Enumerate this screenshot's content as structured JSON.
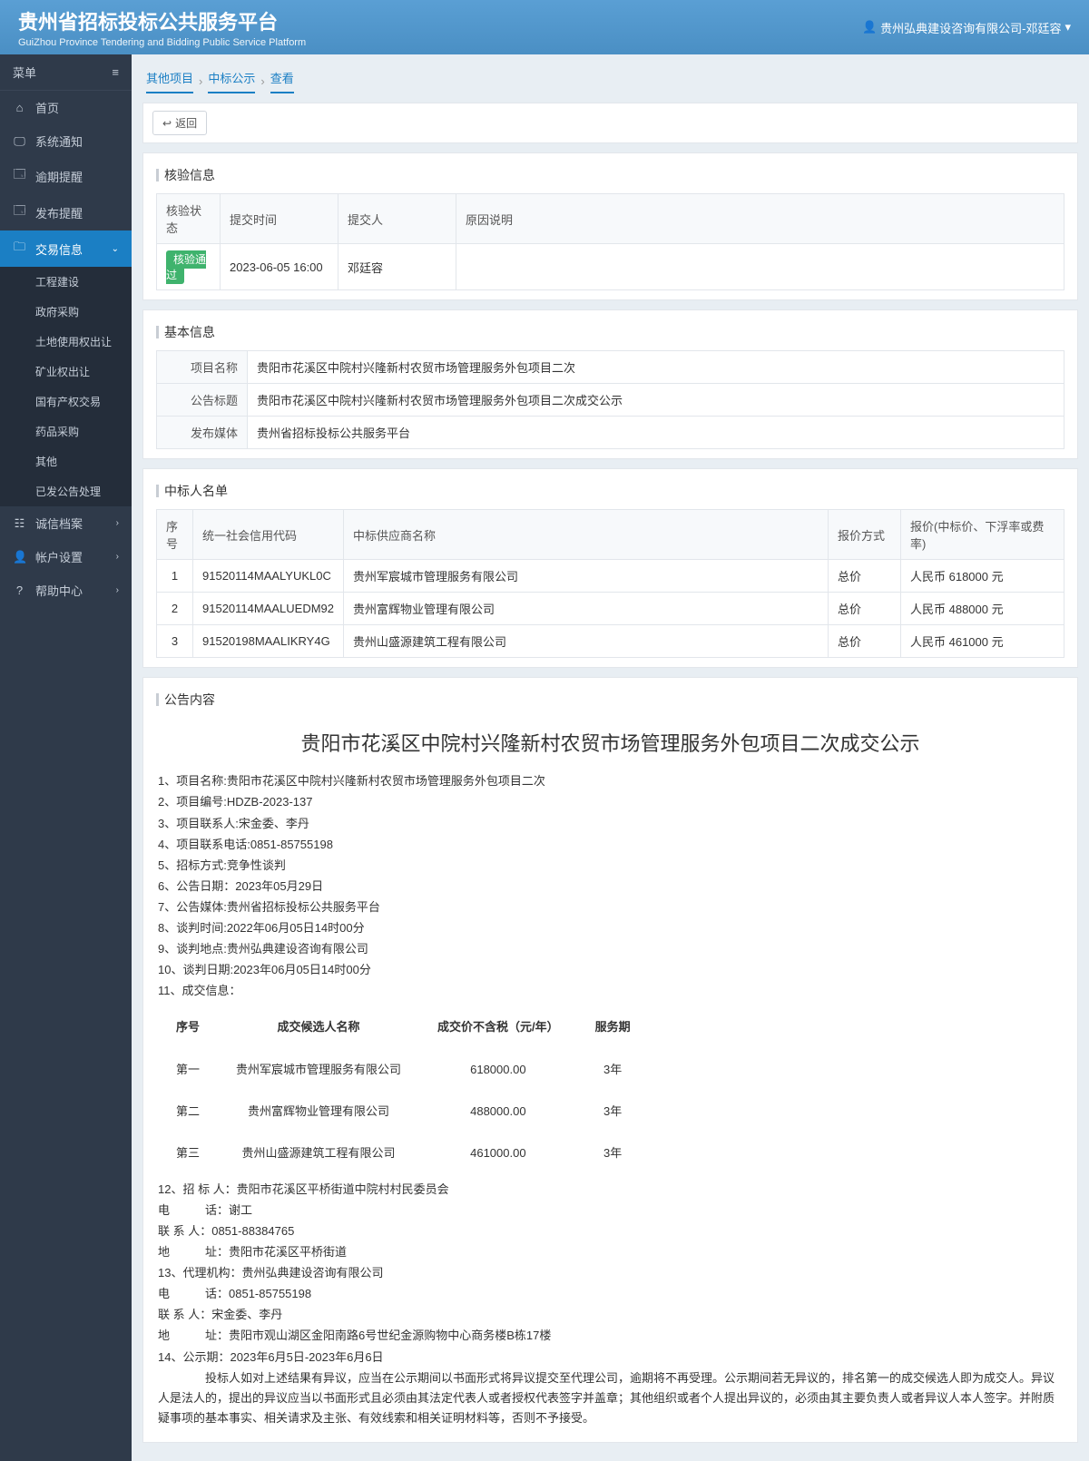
{
  "header": {
    "title": "贵州省招标投标公共服务平台",
    "subtitle": "GuiZhou Province Tendering and Bidding Public Service Platform",
    "user": "贵州弘典建设咨询有限公司-邓廷容"
  },
  "sidebar": {
    "menu_label": "菜单",
    "items": [
      {
        "icon": "⌂",
        "label": "首页"
      },
      {
        "icon": "🖵",
        "label": "系统通知"
      },
      {
        "icon": "🗔",
        "label": "逾期提醒"
      },
      {
        "icon": "🗔",
        "label": "发布提醒"
      }
    ],
    "trade": {
      "icon": "🗀",
      "label": "交易信息"
    },
    "trade_sub": [
      "工程建设",
      "政府采购",
      "土地使用权出让",
      "矿业权出让",
      "国有产权交易",
      "药品采购",
      "其他",
      "已发公告处理"
    ],
    "tail": [
      {
        "icon": "☷",
        "label": "诚信档案"
      },
      {
        "icon": "👤",
        "label": "帐户设置"
      },
      {
        "icon": "?",
        "label": "帮助中心"
      }
    ]
  },
  "breadcrumb": [
    "其他项目",
    "中标公示",
    "查看"
  ],
  "back_label": "返回",
  "verify": {
    "title": "核验信息",
    "headers": [
      "核验状态",
      "提交时间",
      "提交人",
      "原因说明"
    ],
    "status_badge": "核验通过",
    "submit_time": "2023-06-05 16:00",
    "submitter": "邓廷容",
    "reason": ""
  },
  "basic": {
    "title": "基本信息",
    "rows": [
      {
        "label": "项目名称",
        "value": "贵阳市花溪区中院村兴隆新村农贸市场管理服务外包项目二次"
      },
      {
        "label": "公告标题",
        "value": "贵阳市花溪区中院村兴隆新村农贸市场管理服务外包项目二次成交公示"
      },
      {
        "label": "发布媒体",
        "value": "贵州省招标投标公共服务平台"
      }
    ]
  },
  "winners": {
    "title": "中标人名单",
    "headers": [
      "序号",
      "统一社会信用代码",
      "中标供应商名称",
      "报价方式",
      "报价(中标价、下浮率或费率)"
    ],
    "rows": [
      {
        "seq": "1",
        "code": "91520114MAALYUKL0C",
        "name": "贵州军宸城市管理服务有限公司",
        "method": "总价",
        "price": "人民币 618000 元"
      },
      {
        "seq": "2",
        "code": "91520114MAALUEDM92",
        "name": "贵州富辉物业管理有限公司",
        "method": "总价",
        "price": "人民币 488000 元"
      },
      {
        "seq": "3",
        "code": "91520198MAALIKRY4G",
        "name": "贵州山盛源建筑工程有限公司",
        "method": "总价",
        "price": "人民币 461000 元"
      }
    ]
  },
  "notice": {
    "section_title": "公告内容",
    "title": "贵阳市花溪区中院村兴隆新村农贸市场管理服务外包项目二次成交公示",
    "lines_top": [
      "1、项目名称:贵阳市花溪区中院村兴隆新村农贸市场管理服务外包项目二次",
      "2、项目编号:HDZB-2023-137",
      "3、项目联系人:宋金委、李丹",
      "4、项目联系电话:0851-85755198",
      "5、招标方式:竞争性谈判",
      "6、公告日期：2023年05月29日",
      "7、公告媒体:贵州省招标投标公共服务平台",
      "8、谈判时间:2022年06月05日14时00分",
      "9、谈判地点:贵州弘典建设咨询有限公司",
      "10、谈判日期:2023年06月05日14时00分",
      "11、成交信息："
    ],
    "inner_headers": [
      "序号",
      "成交候选人名称",
      "成交价不含税（元/年）",
      "服务期"
    ],
    "inner_rows": [
      {
        "rank": "第一",
        "name": "贵州军宸城市管理服务有限公司",
        "price": "618000.00",
        "term": "3年"
      },
      {
        "rank": "第二",
        "name": "贵州富辉物业管理有限公司",
        "price": "488000.00",
        "term": "3年"
      },
      {
        "rank": "第三",
        "name": "贵州山盛源建筑工程有限公司",
        "price": "461000.00",
        "term": "3年"
      }
    ],
    "lines_bottom": [
      "12、招 标 人：贵阳市花溪区平桥街道中院村村民委员会",
      "电　　　话：谢工",
      "联 系 人：0851-88384765",
      "地　　　址：贵阳市花溪区平桥街道",
      "13、代理机构：贵州弘典建设咨询有限公司",
      "电　　　话：0851-85755198",
      "联 系 人：宋金委、李丹",
      "地　　　址：贵阳市观山湖区金阳南路6号世纪金源购物中心商务楼B栋17楼",
      "14、公示期：2023年6月5日-2023年6月6日"
    ],
    "footer": "　　投标人如对上述结果有异议，应当在公示期间以书面形式将异议提交至代理公司，逾期将不再受理。公示期间若无异议的，排名第一的成交候选人即为成交人。异议人是法人的，提出的异议应当以书面形式且必须由其法定代表人或者授权代表签字并盖章；其他组织或者个人提出异议的，必须由其主要负责人或者异议人本人签字。并附质疑事项的基本事实、相关请求及主张、有效线索和相关证明材料等，否则不予接受。"
  }
}
